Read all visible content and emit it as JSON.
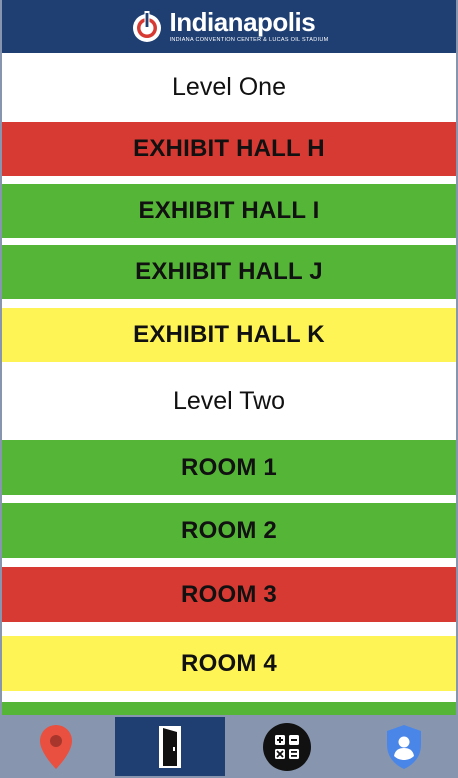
{
  "header": {
    "logo_name": "Indianapolis",
    "logo_subtitle": "INDIANA CONVENTION CENTER & LUCAS OIL STADIUM"
  },
  "list": {
    "items": [
      {
        "kind": "level",
        "label": "Level One"
      },
      {
        "kind": "room",
        "label": "EXHIBIT HALL H",
        "status_color": "red"
      },
      {
        "kind": "room",
        "label": "EXHIBIT HALL I",
        "status_color": "green"
      },
      {
        "kind": "room",
        "label": "EXHIBIT HALL J",
        "status_color": "green"
      },
      {
        "kind": "room",
        "label": "EXHIBIT HALL K",
        "status_color": "yellow"
      },
      {
        "kind": "level",
        "label": "Level Two"
      },
      {
        "kind": "room",
        "label": "ROOM 1",
        "status_color": "green"
      },
      {
        "kind": "room",
        "label": "ROOM 2",
        "status_color": "green"
      },
      {
        "kind": "room",
        "label": "ROOM 3",
        "status_color": "red"
      },
      {
        "kind": "room",
        "label": "ROOM 4",
        "status_color": "yellow"
      },
      {
        "kind": "room",
        "label": "",
        "status_color": "green"
      }
    ]
  },
  "colors": {
    "header_bg": "#1f3f73",
    "red": "#d63a33",
    "green": "#55b537",
    "yellow": "#fff455",
    "tabbar_bg": "#8796ae"
  },
  "tabbar": {
    "tabs": [
      {
        "icon": "map-pin-icon",
        "active": false
      },
      {
        "icon": "door-icon",
        "active": true
      },
      {
        "icon": "calculator-icon",
        "active": false
      },
      {
        "icon": "user-shield-icon",
        "active": false
      }
    ]
  }
}
